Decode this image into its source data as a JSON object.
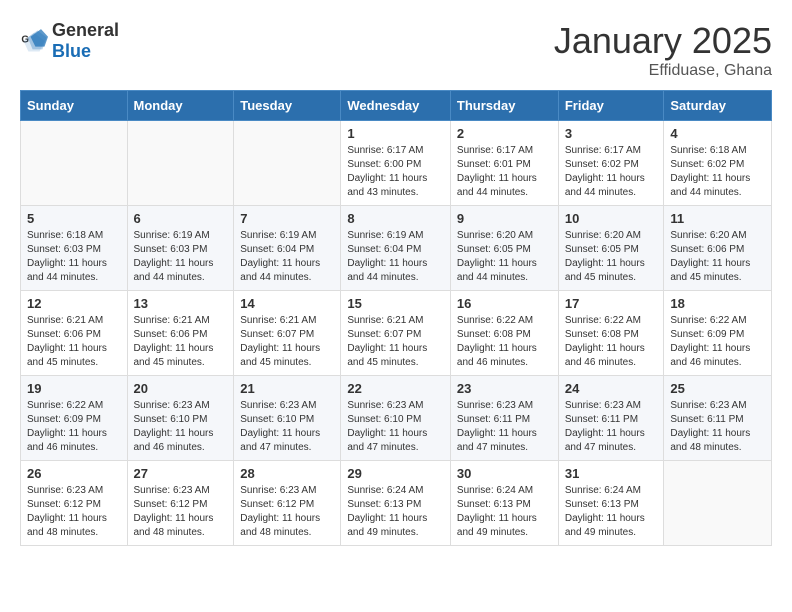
{
  "header": {
    "logo_general": "General",
    "logo_blue": "Blue",
    "month": "January 2025",
    "location": "Effiduase, Ghana"
  },
  "days_of_week": [
    "Sunday",
    "Monday",
    "Tuesday",
    "Wednesday",
    "Thursday",
    "Friday",
    "Saturday"
  ],
  "weeks": [
    [
      {
        "day": "",
        "info": ""
      },
      {
        "day": "",
        "info": ""
      },
      {
        "day": "",
        "info": ""
      },
      {
        "day": "1",
        "info": "Sunrise: 6:17 AM\nSunset: 6:00 PM\nDaylight: 11 hours and 43 minutes."
      },
      {
        "day": "2",
        "info": "Sunrise: 6:17 AM\nSunset: 6:01 PM\nDaylight: 11 hours and 44 minutes."
      },
      {
        "day": "3",
        "info": "Sunrise: 6:17 AM\nSunset: 6:02 PM\nDaylight: 11 hours and 44 minutes."
      },
      {
        "day": "4",
        "info": "Sunrise: 6:18 AM\nSunset: 6:02 PM\nDaylight: 11 hours and 44 minutes."
      }
    ],
    [
      {
        "day": "5",
        "info": "Sunrise: 6:18 AM\nSunset: 6:03 PM\nDaylight: 11 hours and 44 minutes."
      },
      {
        "day": "6",
        "info": "Sunrise: 6:19 AM\nSunset: 6:03 PM\nDaylight: 11 hours and 44 minutes."
      },
      {
        "day": "7",
        "info": "Sunrise: 6:19 AM\nSunset: 6:04 PM\nDaylight: 11 hours and 44 minutes."
      },
      {
        "day": "8",
        "info": "Sunrise: 6:19 AM\nSunset: 6:04 PM\nDaylight: 11 hours and 44 minutes."
      },
      {
        "day": "9",
        "info": "Sunrise: 6:20 AM\nSunset: 6:05 PM\nDaylight: 11 hours and 44 minutes."
      },
      {
        "day": "10",
        "info": "Sunrise: 6:20 AM\nSunset: 6:05 PM\nDaylight: 11 hours and 45 minutes."
      },
      {
        "day": "11",
        "info": "Sunrise: 6:20 AM\nSunset: 6:06 PM\nDaylight: 11 hours and 45 minutes."
      }
    ],
    [
      {
        "day": "12",
        "info": "Sunrise: 6:21 AM\nSunset: 6:06 PM\nDaylight: 11 hours and 45 minutes."
      },
      {
        "day": "13",
        "info": "Sunrise: 6:21 AM\nSunset: 6:06 PM\nDaylight: 11 hours and 45 minutes."
      },
      {
        "day": "14",
        "info": "Sunrise: 6:21 AM\nSunset: 6:07 PM\nDaylight: 11 hours and 45 minutes."
      },
      {
        "day": "15",
        "info": "Sunrise: 6:21 AM\nSunset: 6:07 PM\nDaylight: 11 hours and 45 minutes."
      },
      {
        "day": "16",
        "info": "Sunrise: 6:22 AM\nSunset: 6:08 PM\nDaylight: 11 hours and 46 minutes."
      },
      {
        "day": "17",
        "info": "Sunrise: 6:22 AM\nSunset: 6:08 PM\nDaylight: 11 hours and 46 minutes."
      },
      {
        "day": "18",
        "info": "Sunrise: 6:22 AM\nSunset: 6:09 PM\nDaylight: 11 hours and 46 minutes."
      }
    ],
    [
      {
        "day": "19",
        "info": "Sunrise: 6:22 AM\nSunset: 6:09 PM\nDaylight: 11 hours and 46 minutes."
      },
      {
        "day": "20",
        "info": "Sunrise: 6:23 AM\nSunset: 6:10 PM\nDaylight: 11 hours and 46 minutes."
      },
      {
        "day": "21",
        "info": "Sunrise: 6:23 AM\nSunset: 6:10 PM\nDaylight: 11 hours and 47 minutes."
      },
      {
        "day": "22",
        "info": "Sunrise: 6:23 AM\nSunset: 6:10 PM\nDaylight: 11 hours and 47 minutes."
      },
      {
        "day": "23",
        "info": "Sunrise: 6:23 AM\nSunset: 6:11 PM\nDaylight: 11 hours and 47 minutes."
      },
      {
        "day": "24",
        "info": "Sunrise: 6:23 AM\nSunset: 6:11 PM\nDaylight: 11 hours and 47 minutes."
      },
      {
        "day": "25",
        "info": "Sunrise: 6:23 AM\nSunset: 6:11 PM\nDaylight: 11 hours and 48 minutes."
      }
    ],
    [
      {
        "day": "26",
        "info": "Sunrise: 6:23 AM\nSunset: 6:12 PM\nDaylight: 11 hours and 48 minutes."
      },
      {
        "day": "27",
        "info": "Sunrise: 6:23 AM\nSunset: 6:12 PM\nDaylight: 11 hours and 48 minutes."
      },
      {
        "day": "28",
        "info": "Sunrise: 6:23 AM\nSunset: 6:12 PM\nDaylight: 11 hours and 48 minutes."
      },
      {
        "day": "29",
        "info": "Sunrise: 6:24 AM\nSunset: 6:13 PM\nDaylight: 11 hours and 49 minutes."
      },
      {
        "day": "30",
        "info": "Sunrise: 6:24 AM\nSunset: 6:13 PM\nDaylight: 11 hours and 49 minutes."
      },
      {
        "day": "31",
        "info": "Sunrise: 6:24 AM\nSunset: 6:13 PM\nDaylight: 11 hours and 49 minutes."
      },
      {
        "day": "",
        "info": ""
      }
    ]
  ]
}
